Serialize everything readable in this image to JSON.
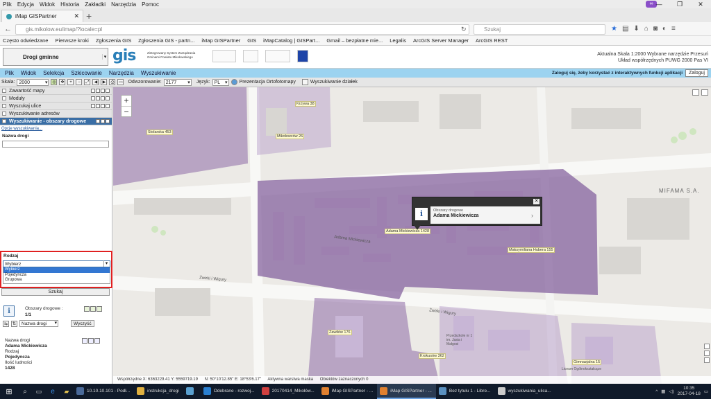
{
  "browser": {
    "menu": [
      "Plik",
      "Edycja",
      "Widok",
      "Historia",
      "Zakładki",
      "Narzędzia",
      "Pomoc"
    ],
    "tab_title": "iMap GISPartner",
    "url": "gis.mikolow.eu/imap/?locale=pl",
    "search_placeholder": "Szukaj",
    "bookmarks": [
      "Często odwiedzane",
      "Pierwsze kroki",
      "Zgłoszenia GIS",
      "Zgłoszenia GIS - partn...",
      "iMap GISPartner",
      "GIS",
      "iMapCatalog | GISPart...",
      "Gmail – bezpłatne mie...",
      "Legalis",
      "ArcGIS Server Manager",
      "ArcGIS REST"
    ]
  },
  "app_header": {
    "layer_select": "Drogi gminne",
    "logo": "gis",
    "logo_sub": "Zintegrowany System Zarządzania Gminami Powiatu Mikołowskiego",
    "scale_line": "Aktualna Skala 1:2000  Wybrane narzędzie Przesuń",
    "crs_line": "Układ współrzędnych PUWG 2000 Pas VI"
  },
  "app_menu": {
    "items": [
      "Plik",
      "Widok",
      "Selekcja",
      "Szkicowanie",
      "Narzędzia",
      "Wyszukiwanie"
    ],
    "login_note": "Zaloguj się, żeby korzystać z interaktywnych funkcji aplikacji",
    "login_button": "Zaloguj"
  },
  "toolbar": {
    "scale_label": "Skala:",
    "scale_value": "2000",
    "refresh_label": "Odwzorowanie:",
    "refresh_value": "2177",
    "lang_label": "Język:",
    "lang_value": "PL",
    "ortho_label": "Prezentacja Ortofotomapy",
    "parcel_label": "Wyszukiwanie działek"
  },
  "left_panel": {
    "accordion": [
      "Zawartość mapy",
      "Moduły",
      "Wyszukaj ulice",
      "Wyszukiwanie adresów"
    ],
    "active_section": "Wyszukiwanie - obszary drogowe",
    "options_link": "Opcje wyszukiwania...",
    "road_name_label": "Nazwa drogi",
    "type_label": "Rodzaj",
    "type_selected": "Wybierz",
    "type_options": [
      "Wybierz",
      "Pojedyncza",
      "Grupowa"
    ],
    "search_button": "Szukaj",
    "results_title": "Obszary drogowe :",
    "results_count": "1/1",
    "sort_value": "Nazwa drogi",
    "clear_button": "Wyczyść",
    "detail": [
      {
        "k": "Nazwa drogi",
        "v": "Adama Mickiewicza"
      },
      {
        "k": "Rodzaj",
        "v": "Pojedyncza"
      },
      {
        "k": "Ilość ludności",
        "v": "1428"
      }
    ]
  },
  "map": {
    "labels": [
      "Stolarska 453",
      "Krzywa 38",
      "Mikołowców 26",
      "Adama Mickiewicza 1428",
      "Maksymiliana Hubera 155",
      "Zawiłów 176",
      "Krokusów 362",
      "Gimnazjalna 15"
    ],
    "streets": [
      "Adama Mickiewicza",
      "Żwirki i Wigury",
      "Żwirki i Wigury"
    ],
    "poi": [
      "MIFAMA S.A.",
      "Przedszkole nr 1 im. Jasia i Małgosi",
      "Liceum Ogólnokształcące"
    ],
    "popup": {
      "category": "Obszary drogowe",
      "name": "Adama Mickiewicza"
    },
    "status": {
      "coords": "Współrzędne X: 6363229.41 Y: 5559719.19",
      "geo": "N: 50°10'12.85\" E: 18°53'6.17\"",
      "layer": "Aktywna warstwa maska",
      "selected": "Obiektów zaznaczonych 0"
    }
  },
  "taskbar": {
    "apps": [
      "10.10.10.101 - Podł...",
      "instrukcja_drogi",
      "",
      "Odebrane - rozwoj...",
      "20170414_Mikołów...",
      "iMap GISPartner - ...",
      "iMap GISPartner - ...",
      "Bez tytułu 1 - Libre...",
      "wyszukiwania_ulica..."
    ],
    "time": "10:35",
    "date": "2017-04-18"
  },
  "colors": {
    "accent_blue": "#9cd3f0",
    "highlight_red": "#e02020",
    "road_area": "#8e6aa6"
  }
}
